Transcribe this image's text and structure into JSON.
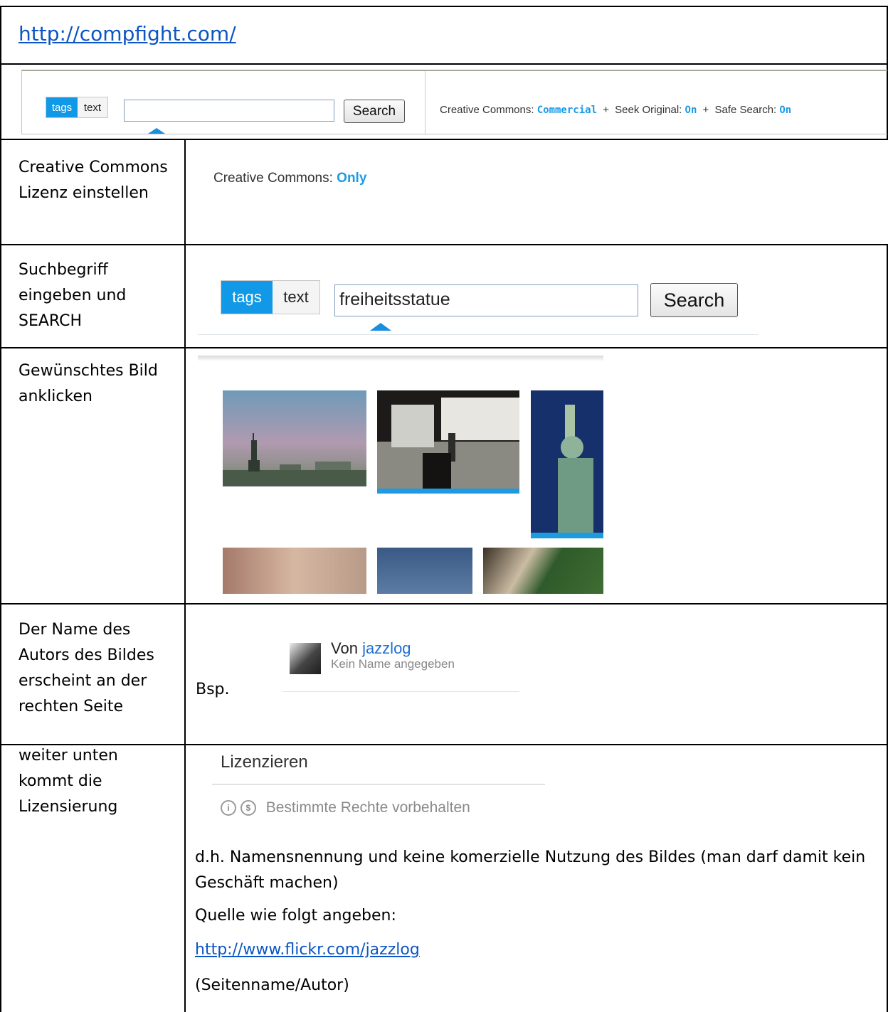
{
  "url_header": "http://compfight.com/",
  "toolbar": {
    "tags": "tags",
    "text": "text",
    "search": "Search",
    "cc_label": "Creative Commons:",
    "cc_value": "Commercial",
    "plus": "+",
    "seek_label": "Seek Original:",
    "seek_value": "On",
    "safe_label": "Safe Search:",
    "safe_value": "On"
  },
  "rows": [
    {
      "label": "Creative Commons Lizenz einstellen"
    },
    {
      "label": "Suchbegriff eingeben und SEARCH"
    },
    {
      "label": "Gewünschtes Bild anklicken"
    },
    {
      "label": "Der Name des Autors des Bildes erscheint an der rechten Seite"
    },
    {
      "label": "weiter unten kommt die Lizensierung"
    }
  ],
  "cc_only": {
    "label": "Creative Commons:",
    "value": "Only"
  },
  "search2": {
    "tags": "tags",
    "text": "text",
    "query": "freiheitsstatue",
    "button": "Search"
  },
  "author": {
    "bsp": "Bsp.",
    "von": "Von",
    "name": "jazzlog",
    "sub": "Kein Name angegeben"
  },
  "license": {
    "title": "Lizenzieren",
    "rights": "Bestimmte Rechte vorbehalten",
    "desc": "d.h. Namensnennung und keine komerzielle Nutzung des Bildes (man darf damit kein Geschäft machen)",
    "source_label": "Quelle wie folgt angeben:",
    "source_url": "http://www.flickr.com/jazzlog",
    "note": "(Seitenname/Autor)"
  }
}
